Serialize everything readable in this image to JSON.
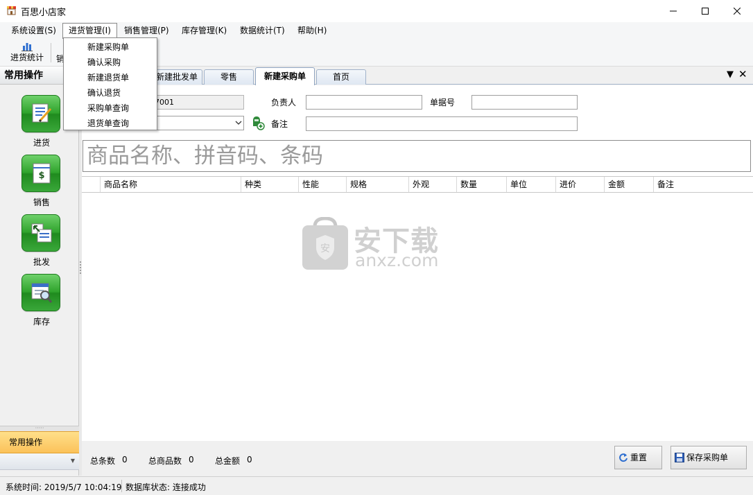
{
  "window": {
    "title": "百思小店家",
    "icon": "shop-icon"
  },
  "menubar": {
    "items": [
      {
        "label": "系统设置(S)"
      },
      {
        "label": "进货管理(I)"
      },
      {
        "label": "销售管理(P)"
      },
      {
        "label": "库存管理(K)"
      },
      {
        "label": "数据统计(T)"
      },
      {
        "label": "帮助(H)"
      }
    ],
    "open_menu": "进货管理(I)"
  },
  "dropdown": {
    "items": [
      {
        "label": "新建采购单"
      },
      {
        "label": "确认采购"
      },
      {
        "label": "新建退货单"
      },
      {
        "label": "确认退货"
      },
      {
        "label": "采购单查询"
      },
      {
        "label": "退货单查询"
      }
    ]
  },
  "toolbar": {
    "stats_label": "进货统计",
    "sales_partial": "销"
  },
  "sidebar": {
    "header": "常用操作",
    "buttons": [
      {
        "label": "进货",
        "icon": "purchase-icon"
      },
      {
        "label": "销售",
        "icon": "sales-icon"
      },
      {
        "label": "批发",
        "icon": "wholesale-icon"
      },
      {
        "label": "库存",
        "icon": "inventory-icon"
      }
    ],
    "active_group": "常用操作"
  },
  "tabs": {
    "items": [
      {
        "label": "新建批发单"
      },
      {
        "label": "零售"
      },
      {
        "label": "新建采购单",
        "active": true
      },
      {
        "label": "首页"
      }
    ]
  },
  "form": {
    "order_id_partial": "7001",
    "manager_label": "负责人",
    "manager_value": "",
    "doc_no_label": "单据号",
    "doc_no_value": "",
    "supplier_value": "",
    "remark_label": "备注",
    "remark_value": ""
  },
  "search": {
    "placeholder": "商品名称、拼音码、条码"
  },
  "grid": {
    "columns": [
      "商品名称",
      "种类",
      "性能",
      "规格",
      "外观",
      "数量",
      "单位",
      "进价",
      "金额",
      "备注"
    ],
    "rows": []
  },
  "watermark": {
    "cn_text": "安下载",
    "en_text": "anxz.com"
  },
  "footer": {
    "total_rows_label": "总条数",
    "total_rows_value": "0",
    "total_qty_label": "总商品数",
    "total_qty_value": "0",
    "total_amount_label": "总金额",
    "total_amount_value": "0",
    "reset_label": "重置",
    "save_label": "保存采购单"
  },
  "statusbar": {
    "time_text": "系统时间:  2019/5/7 10:04:19",
    "db_text": "数据库状态:  连接成功"
  }
}
